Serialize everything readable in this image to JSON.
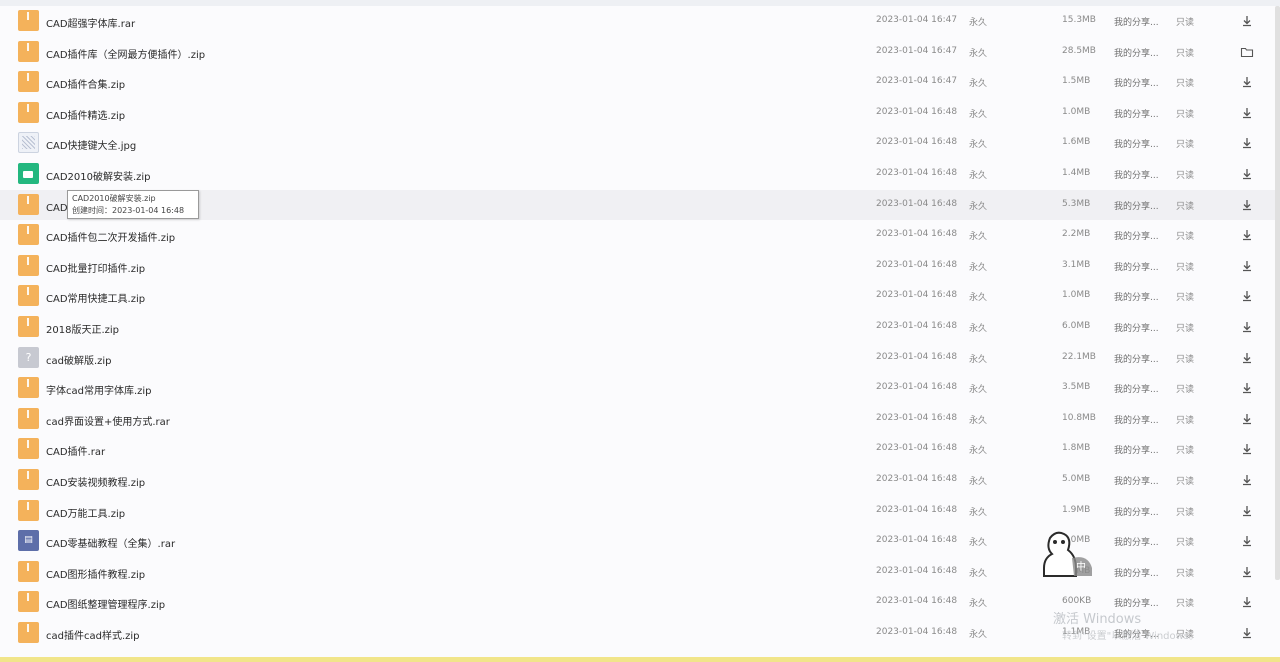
{
  "files": [
    {
      "icon": "zip",
      "name": "CAD超强字体库.rar",
      "date": "2023-01-04 16:47",
      "type": "永久",
      "size": "15.3MB",
      "share": "我的分享...",
      "location": "只读",
      "action": "download-icon"
    },
    {
      "icon": "zip",
      "name": "CAD插件库（全网最方便插件）.zip",
      "date": "2023-01-04 16:47",
      "type": "永久",
      "size": "28.5MB",
      "share": "我的分享...",
      "location": "只读",
      "action": "folder-icon"
    },
    {
      "icon": "zip",
      "name": "CAD插件合集.zip",
      "date": "2023-01-04 16:47",
      "type": "永久",
      "size": "1.5MB",
      "share": "我的分享...",
      "location": "只读",
      "action": "download-icon"
    },
    {
      "icon": "zip",
      "name": "CAD插件精选.zip",
      "date": "2023-01-04 16:48",
      "type": "永久",
      "size": "1.0MB",
      "share": "我的分享...",
      "location": "只读",
      "action": "download-icon"
    },
    {
      "icon": "jpg",
      "name": "CAD快捷键大全.jpg",
      "date": "2023-01-04 16:48",
      "type": "永久",
      "size": "1.6MB",
      "share": "我的分享...",
      "location": "只读",
      "action": "download-icon"
    },
    {
      "icon": "img",
      "name": "CAD2010破解安装.zip",
      "date": "2023-01-04 16:48",
      "type": "永久",
      "size": "1.4MB",
      "share": "我的分享...",
      "location": "只读",
      "action": "download-icon"
    },
    {
      "icon": "zip",
      "name": "CAD2010破解安装.zip",
      "date": "2023-01-04 16:48",
      "type": "永久",
      "size": "5.3MB",
      "share": "我的分享...",
      "location": "只读",
      "action": "download-icon",
      "hover": true
    },
    {
      "icon": "zip",
      "name": "CAD插件包二次开发插件.zip",
      "date": "2023-01-04 16:48",
      "type": "永久",
      "size": "2.2MB",
      "share": "我的分享...",
      "location": "只读",
      "action": "download-icon"
    },
    {
      "icon": "zip",
      "name": "CAD批量打印插件.zip",
      "date": "2023-01-04 16:48",
      "type": "永久",
      "size": "3.1MB",
      "share": "我的分享...",
      "location": "只读",
      "action": "download-icon"
    },
    {
      "icon": "zip",
      "name": "CAD常用快捷工具.zip",
      "date": "2023-01-04 16:48",
      "type": "永久",
      "size": "1.0MB",
      "share": "我的分享...",
      "location": "只读",
      "action": "download-icon"
    },
    {
      "icon": "zip",
      "name": "2018版天正.zip",
      "date": "2023-01-04 16:48",
      "type": "永久",
      "size": "6.0MB",
      "share": "我的分享...",
      "location": "只读",
      "action": "download-icon"
    },
    {
      "icon": "unk",
      "name": "cad破解版.zip",
      "date": "2023-01-04 16:48",
      "type": "永久",
      "size": "22.1MB",
      "share": "我的分享...",
      "location": "只读",
      "action": "download-icon"
    },
    {
      "icon": "zip",
      "name": "字体cad常用字体库.zip",
      "date": "2023-01-04 16:48",
      "type": "永久",
      "size": "3.5MB",
      "share": "我的分享...",
      "location": "只读",
      "action": "download-icon"
    },
    {
      "icon": "zip",
      "name": "cad界面设置+使用方式.rar",
      "date": "2023-01-04 16:48",
      "type": "永久",
      "size": "10.8MB",
      "share": "我的分享...",
      "location": "只读",
      "action": "download-icon"
    },
    {
      "icon": "zip",
      "name": "CAD插件.rar",
      "date": "2023-01-04 16:48",
      "type": "永久",
      "size": "1.8MB",
      "share": "我的分享...",
      "location": "只读",
      "action": "download-icon"
    },
    {
      "icon": "zip",
      "name": "CAD安装视频教程.zip",
      "date": "2023-01-04 16:48",
      "type": "永久",
      "size": "5.0MB",
      "share": "我的分享...",
      "location": "只读",
      "action": "download-icon"
    },
    {
      "icon": "zip",
      "name": "CAD万能工具.zip",
      "date": "2023-01-04 16:48",
      "type": "永久",
      "size": "1.9MB",
      "share": "我的分享...",
      "location": "只读",
      "action": "download-icon"
    },
    {
      "icon": "doc",
      "name": "CAD零基础教程（全集）.rar",
      "date": "2023-01-04 16:48",
      "type": "永久",
      "size": "9.0MB",
      "share": "我的分享...",
      "location": "只读",
      "action": "download-icon"
    },
    {
      "icon": "zip",
      "name": "CAD图形插件教程.zip",
      "date": "2023-01-04 16:48",
      "type": "永久",
      "size": "1.0MB",
      "share": "我的分享...",
      "location": "只读",
      "action": "download-icon"
    },
    {
      "icon": "zip",
      "name": "CAD图纸整理管理程序.zip",
      "date": "2023-01-04 16:48",
      "type": "永久",
      "size": "600KB",
      "share": "我的分享...",
      "location": "只读",
      "action": "download-icon"
    },
    {
      "icon": "zip",
      "name": "cad插件cad样式.zip",
      "date": "2023-01-04 16:48",
      "type": "永久",
      "size": "1.1MB",
      "share": "我的分享...",
      "location": "只读",
      "action": "download-icon"
    }
  ],
  "tooltip": {
    "line1": "CAD2010破解安装.zip",
    "line2": "创建时间：2023-01-04 16:48"
  },
  "watermark": {
    "title": "激活 Windows",
    "subtitle": "转到\"设置\"以激活 Windows。"
  },
  "colors": {
    "zip": "#f4b25b",
    "img": "#23b77f",
    "doc": "#5d6ea9",
    "unk": "#c7c9d1"
  }
}
